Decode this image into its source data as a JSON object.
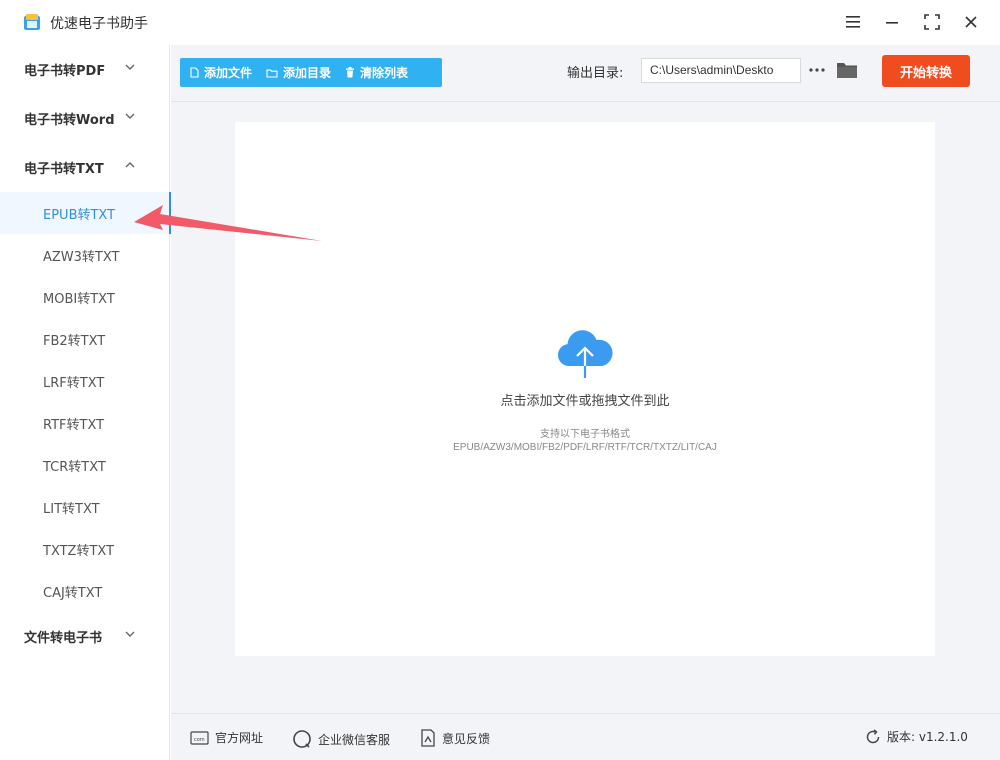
{
  "app": {
    "title": "优速电子书助手",
    "icons": {
      "app": "book-app-icon",
      "menu": "hamburger-icon",
      "minimize": "minimize-icon",
      "maximize": "maximize-icon",
      "close": "close-icon"
    }
  },
  "sidebar": {
    "groups": [
      {
        "label": "电子书转PDF",
        "expanded": false
      },
      {
        "label": "电子书转Word",
        "expanded": false
      },
      {
        "label": "电子书转TXT",
        "expanded": true
      },
      {
        "label": "文件转电子书",
        "expanded": false
      }
    ],
    "items": [
      {
        "label": "EPUB转TXT",
        "active": true
      },
      {
        "label": "AZW3转TXT",
        "active": false
      },
      {
        "label": "MOBI转TXT",
        "active": false
      },
      {
        "label": "FB2转TXT",
        "active": false
      },
      {
        "label": "LRF转TXT",
        "active": false
      },
      {
        "label": "RTF转TXT",
        "active": false
      },
      {
        "label": "TCR转TXT",
        "active": false
      },
      {
        "label": "LIT转TXT",
        "active": false
      },
      {
        "label": "TXTZ转TXT",
        "active": false
      },
      {
        "label": "CAJ转TXT",
        "active": false
      }
    ]
  },
  "toolbar": {
    "add_file": "添加文件",
    "add_dir": "添加目录",
    "clear_list": "清除列表",
    "output_label": "输出目录:",
    "output_path": "C:\\Users\\admin\\Deskto",
    "start": "开始转换"
  },
  "dropzone": {
    "main_text": "点击添加文件或拖拽文件到此",
    "sub_text": "支持以下电子书格式",
    "formats": "EPUB/AZW3/MOBI/FB2/PDF/LRF/RTF/TCR/TXTZ/LIT/CAJ"
  },
  "footer": {
    "website": "官方网址",
    "wechat": "企业微信客服",
    "feedback": "意见反馈",
    "version": "版本: v1.2.1.0"
  },
  "colors": {
    "accent": "#2f8fe6",
    "toolbar_btn": "#2fb1f2",
    "start_btn": "#f04c1f",
    "annotation_arrow": "#f25a6a"
  }
}
